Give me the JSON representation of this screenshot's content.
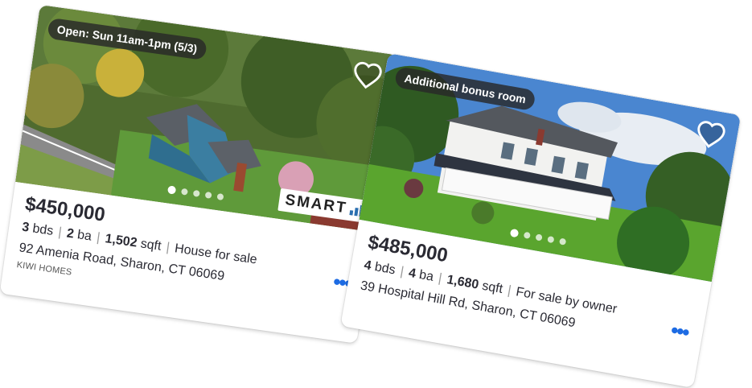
{
  "listings": [
    {
      "badge": "Open: Sun 11am-1pm (5/3)",
      "price": "$450,000",
      "beds": "3",
      "beds_unit": "bds",
      "baths": "2",
      "baths_unit": "ba",
      "sqft": "1,502",
      "sqft_unit": "sqft",
      "type": "House for sale",
      "address": "92 Amenia Road, Sharon, CT 06069",
      "broker": "KIWI HOMES",
      "logo_text": "SMART",
      "more_label": "•••",
      "photo_index": 1,
      "photo_count": 5,
      "favorite_icon": "heart-outline-icon"
    },
    {
      "badge": "Additional bonus room",
      "price": "$485,000",
      "beds": "4",
      "beds_unit": "bds",
      "baths": "4",
      "baths_unit": "ba",
      "sqft": "1,680",
      "sqft_unit": "sqft",
      "type": "For sale by owner",
      "address": "39 Hospital Hill Rd, Sharon, CT 06069",
      "more_label": "•••",
      "photo_index": 1,
      "photo_count": 5,
      "favorite_icon": "heart-outline-icon"
    }
  ],
  "colors": {
    "accent": "#1d6be3",
    "text": "#2a2a33",
    "badge_bg": "#282828"
  }
}
